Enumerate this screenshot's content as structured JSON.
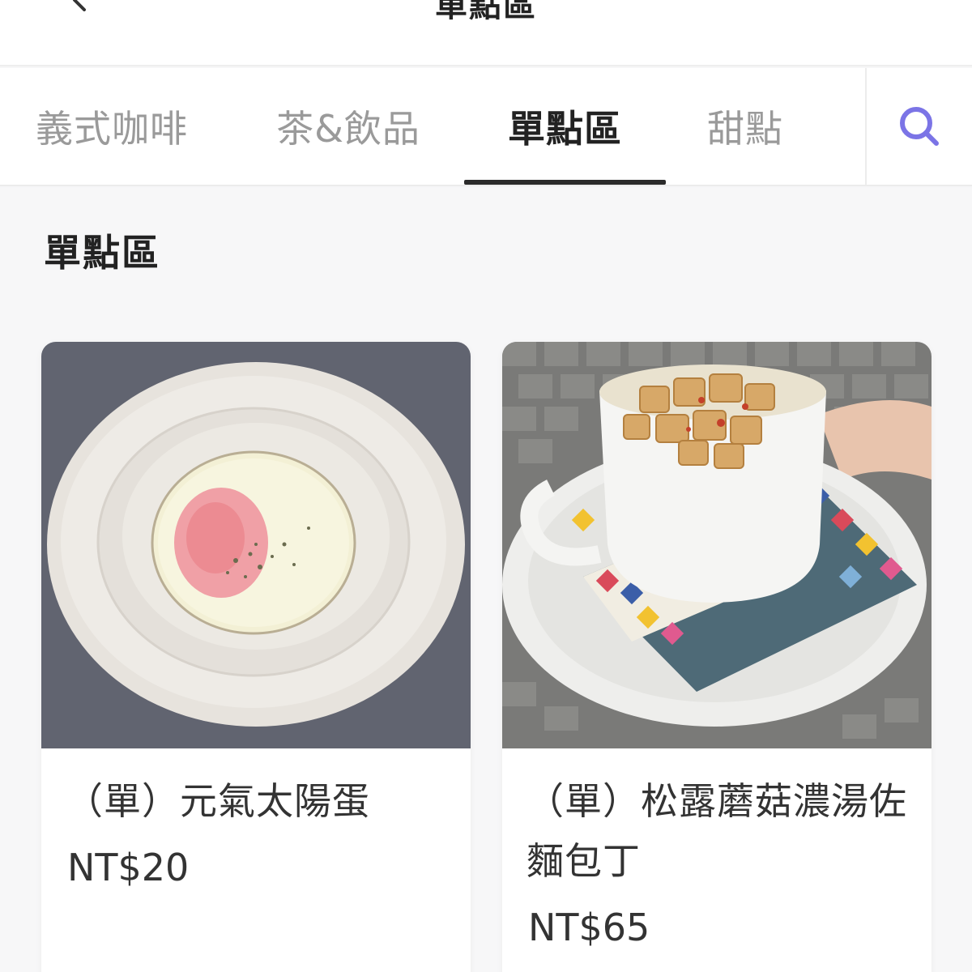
{
  "header": {
    "title": "單點區"
  },
  "tabs": [
    {
      "label": "義式咖啡",
      "active": false
    },
    {
      "label": "茶&飲品",
      "active": false
    },
    {
      "label": "單點區",
      "active": true
    },
    {
      "label": "甜點",
      "active": false
    }
  ],
  "search": {
    "icon": "search-icon",
    "color": "#7b74e6"
  },
  "section": {
    "title": "單點區"
  },
  "products": [
    {
      "name": "（單）元氣太陽蛋",
      "price": "NT$20",
      "image": "fried-egg-on-plate"
    },
    {
      "name": "（單）松露蘑菇濃湯佐麵包丁",
      "price": "NT$65",
      "image": "mushroom-soup-with-croutons"
    }
  ],
  "colors": {
    "accent": "#7b74e6",
    "active_tab": "#222222",
    "inactive_tab": "#9a9a9a",
    "underline": "#2b2b2b"
  }
}
